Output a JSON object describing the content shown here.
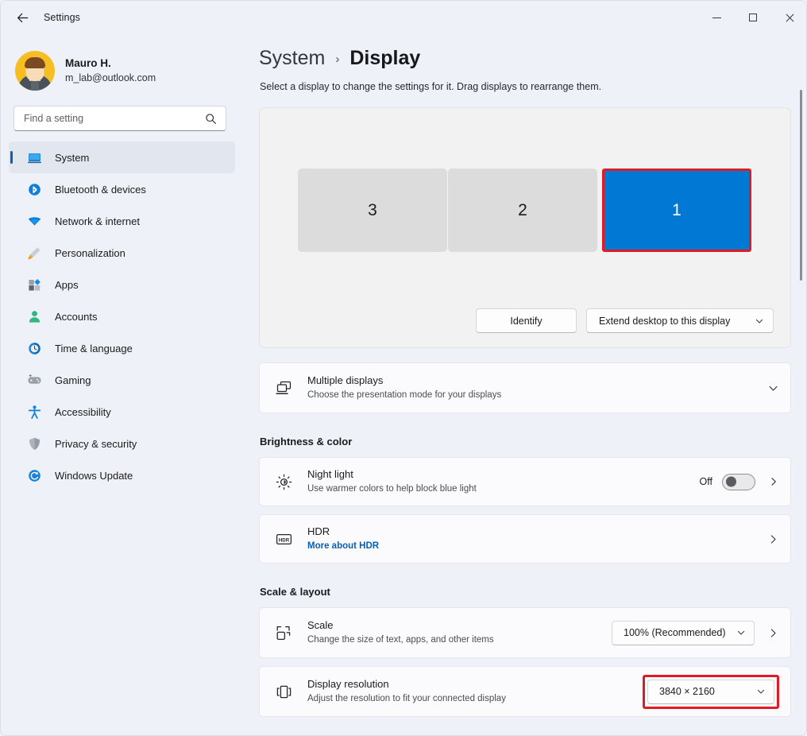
{
  "window": {
    "title": "Settings",
    "back_label": "Back",
    "minimize_label": "Minimize",
    "maximize_label": "Maximize",
    "close_label": "Close"
  },
  "account": {
    "name": "Mauro H.",
    "email": "m_lab@outlook.com"
  },
  "search": {
    "placeholder": "Find a setting",
    "value": ""
  },
  "sidebar": {
    "items": [
      {
        "label": "System",
        "icon": "monitor-icon",
        "active": true
      },
      {
        "label": "Bluetooth & devices",
        "icon": "bluetooth-icon",
        "active": false
      },
      {
        "label": "Network & internet",
        "icon": "wifi-icon",
        "active": false
      },
      {
        "label": "Personalization",
        "icon": "brush-icon",
        "active": false
      },
      {
        "label": "Apps",
        "icon": "apps-icon",
        "active": false
      },
      {
        "label": "Accounts",
        "icon": "person-icon",
        "active": false
      },
      {
        "label": "Time & language",
        "icon": "clock-icon",
        "active": false
      },
      {
        "label": "Gaming",
        "icon": "gamepad-icon",
        "active": false
      },
      {
        "label": "Accessibility",
        "icon": "accessibility-icon",
        "active": false
      },
      {
        "label": "Privacy & security",
        "icon": "shield-icon",
        "active": false
      },
      {
        "label": "Windows Update",
        "icon": "update-icon",
        "active": false
      }
    ]
  },
  "header": {
    "breadcrumb_root": "System",
    "breadcrumb_separator": "›",
    "breadcrumb_current": "Display",
    "subtitle": "Select a display to change the settings for it. Drag displays to rearrange them."
  },
  "arrangement": {
    "monitors": [
      {
        "label": "3",
        "selected": false
      },
      {
        "label": "2",
        "selected": false
      },
      {
        "label": "1",
        "selected": true
      }
    ],
    "identify_button": "Identify",
    "mode_dropdown": "Extend desktop to this display"
  },
  "multiple_displays": {
    "title": "Multiple displays",
    "subtitle": "Choose the presentation mode for your displays",
    "icon": "multiple-displays-icon"
  },
  "brightness_section": {
    "heading": "Brightness & color",
    "night_light": {
      "title": "Night light",
      "subtitle": "Use warmer colors to help block blue light",
      "toggle_state": "Off",
      "icon": "night-light-icon"
    },
    "hdr": {
      "title": "HDR",
      "subtitle": "More about HDR",
      "icon": "hdr-icon"
    }
  },
  "scale_section": {
    "heading": "Scale & layout",
    "scale": {
      "title": "Scale",
      "subtitle": "Change the size of text, apps, and other items",
      "value": "100% (Recommended)",
      "icon": "scale-icon"
    },
    "resolution": {
      "title": "Display resolution",
      "subtitle": "Adjust the resolution to fit your connected display",
      "value": "3840 × 2160",
      "icon": "resolution-icon",
      "highlighted": true
    }
  },
  "colors": {
    "accent": "#0078d4",
    "highlight": "#e01b24",
    "link": "#0a5fb5",
    "window_bg": "#eef1f8",
    "card_bg": "#fbfbfd",
    "panel_bg": "#f2f2f2"
  }
}
